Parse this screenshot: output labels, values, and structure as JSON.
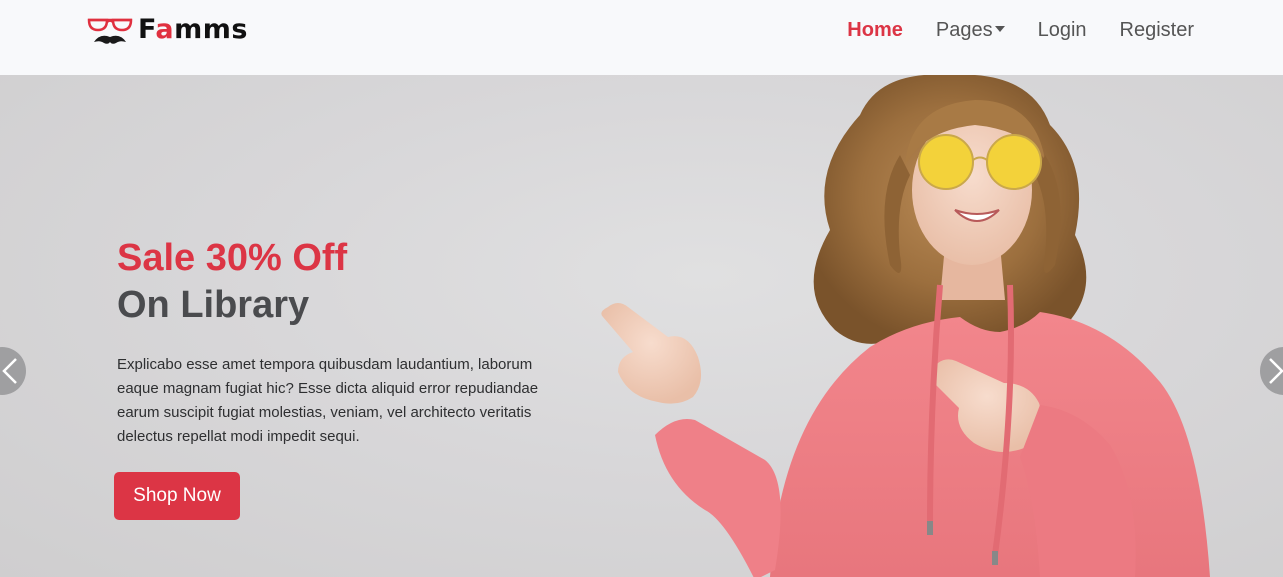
{
  "brand": {
    "name_prefix": "F",
    "name_accent": "a",
    "name_suffix": "mms",
    "logo_icon": "glasses-mustache-icon"
  },
  "nav": {
    "items": [
      {
        "label": "Home",
        "active": true
      },
      {
        "label": "Pages",
        "dropdown": true
      },
      {
        "label": "Login"
      },
      {
        "label": "Register"
      }
    ]
  },
  "hero": {
    "title_line1": "Sale 30% Off",
    "title_line2": "On Library",
    "description": "Explicabo esse amet tempora quibusdam laudantium, laborum eaque magnam fugiat hic? Esse dicta aliquid error repudiandae earum suscipit fugiat molestias, veniam, vel architecto veritatis delectus repellat modi impedit sequi.",
    "cta_label": "Shop Now",
    "prev_icon": "chevron-left-icon",
    "next_icon": "chevron-right-icon"
  },
  "colors": {
    "accent": "#dc3545",
    "navbar_bg": "#f8f9fb",
    "hero_bg": "#d8d7d9",
    "hoodie": "#ef7f86"
  }
}
